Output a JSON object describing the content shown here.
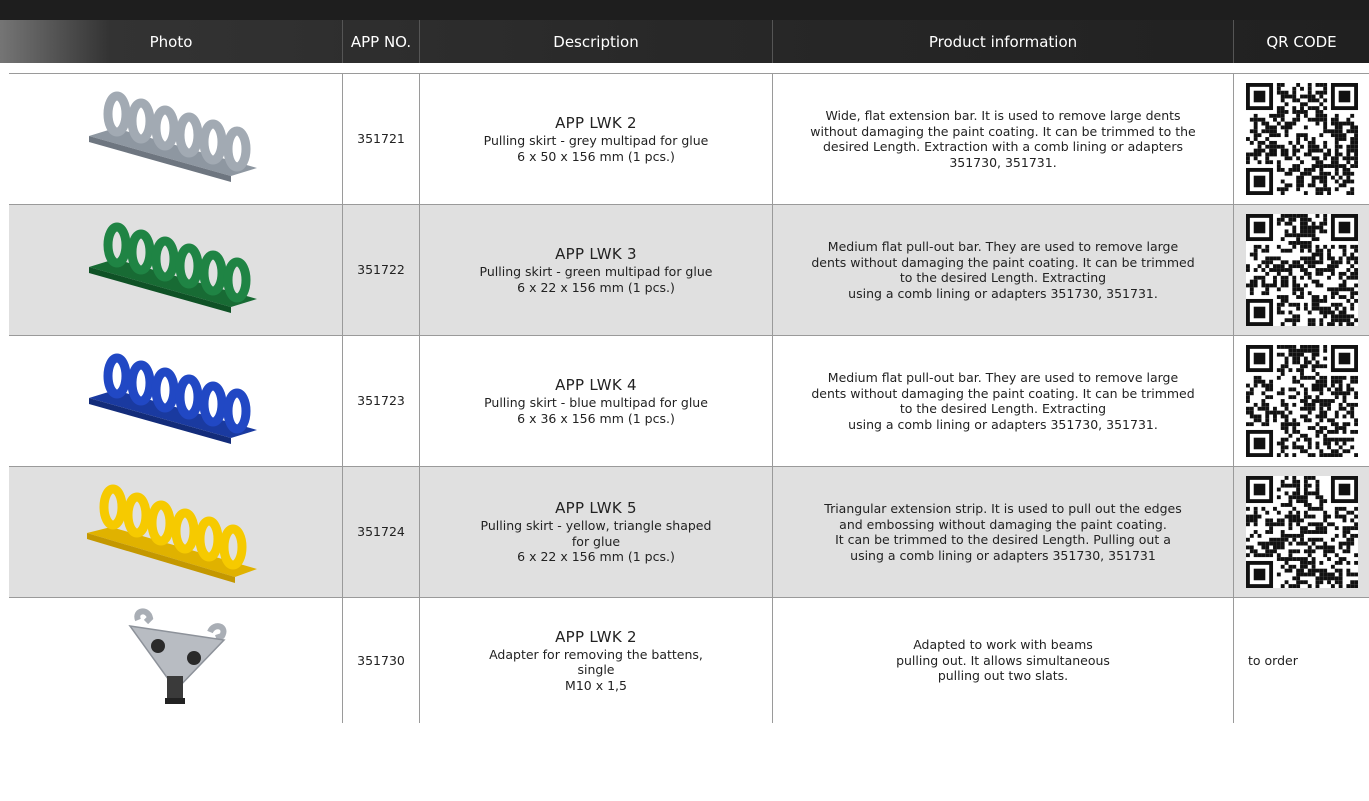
{
  "header": {
    "photo": "Photo",
    "app_no": "APP NO.",
    "description": "Description",
    "product_info": "Product information",
    "qr_code": "QR CODE"
  },
  "rows": [
    {
      "app_no": "351721",
      "title": "APP LWK 2",
      "subtitle": "Pulling skirt - grey multipad for glue\n6 x 50 x 156 mm (1 pcs.)",
      "info": "Wide, flat extension bar. It is used to remove large dents\nwithout damaging the paint coating. It can be trimmed to the\ndesired Length. Extraction with a comb lining or adapters\n351730, 351731.",
      "product_color": "#9aa3ad",
      "qr": ""
    },
    {
      "app_no": "351722",
      "title": "APP LWK 3",
      "subtitle": "Pulling skirt - green multipad for glue\n6 x 22 x 156 mm (1 pcs.)",
      "info": "Medium flat pull-out bar. They are used to remove large\ndents without damaging the paint coating. It can be trimmed\nto the desired Length. Extracting\nusing a comb lining or adapters 351730, 351731.",
      "product_color": "#1e7a3e",
      "qr": ""
    },
    {
      "app_no": "351723",
      "title": "APP LWK 4",
      "subtitle": "Pulling skirt - blue multipad for glue\n6 x 36 x 156 mm (1 pcs.)",
      "info": "Medium flat pull-out bar. They are used to remove large\ndents without damaging the paint coating. It can be trimmed\nto the desired Length. Extracting\nusing a comb lining or adapters 351730, 351731.",
      "product_color": "#1d3fb0",
      "qr": ""
    },
    {
      "app_no": "351724",
      "title": "APP LWK 5",
      "subtitle": "Pulling skirt - yellow, triangle shaped\nfor glue\n6 x 22 x 156 mm (1 pcs.)",
      "info": "Triangular extension strip. It is used to pull out the edges\nand embossing without damaging the paint coating.\nIt can be trimmed to the desired Length. Pulling out a\nusing a comb lining or adapters 351730, 351731",
      "product_color": "#f2c400",
      "qr": ""
    },
    {
      "app_no": "351730",
      "title": "APP LWK 2",
      "subtitle": "Adapter for removing the battens,\nsingle\nM10 x 1,5",
      "info": "Adapted to work with beams\npulling out. It allows simultaneous\npulling out two slats.",
      "product_color": "#b8bcc2",
      "qr": "to order"
    }
  ]
}
